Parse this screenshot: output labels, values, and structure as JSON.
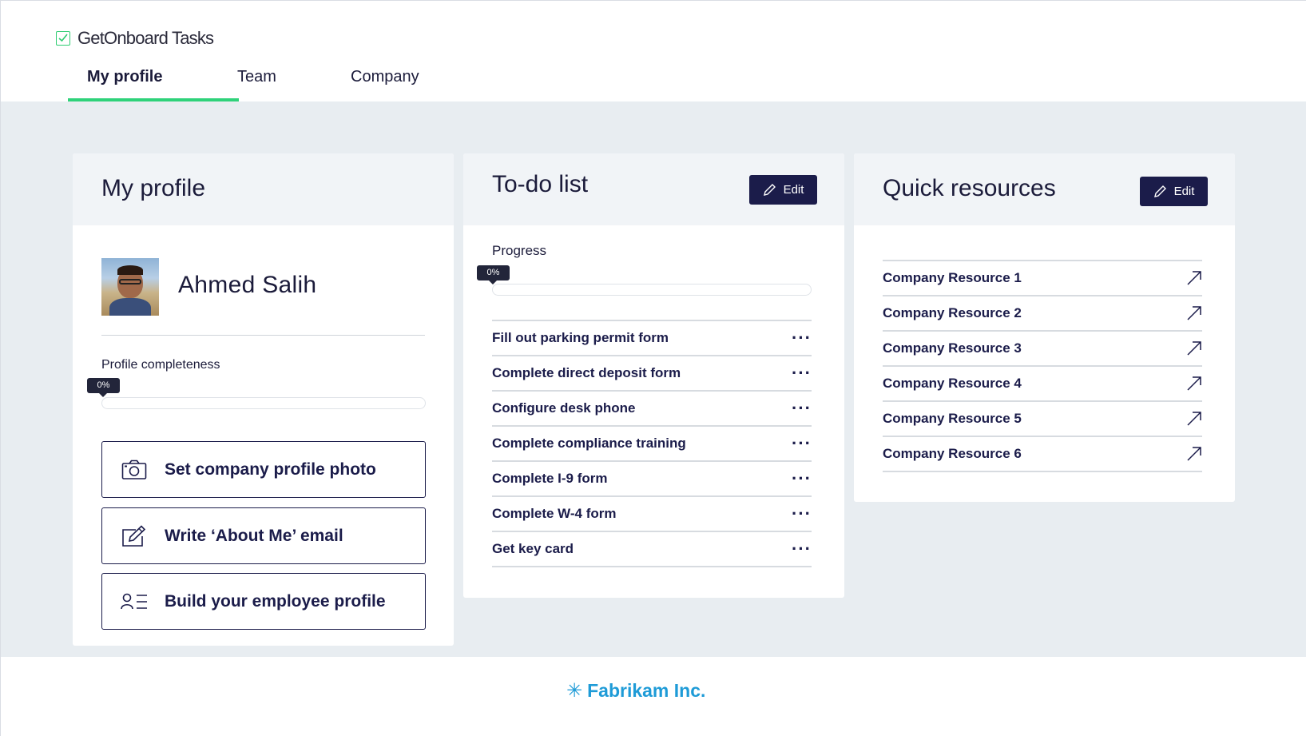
{
  "app": {
    "brand": "GetOnboard Tasks",
    "accent": "#2fd27a",
    "primary": "#1b1c4a"
  },
  "nav": {
    "tabs": [
      {
        "label": "My profile",
        "active": true
      },
      {
        "label": "Team",
        "active": false
      },
      {
        "label": "Company",
        "active": false
      }
    ]
  },
  "profile": {
    "title": "My profile",
    "name": "Ahmed Salih",
    "completeness_label": "Profile completeness",
    "completeness_value": "0%",
    "completeness_fraction": 0,
    "actions": [
      {
        "label": "Set company profile photo",
        "icon": "camera-icon"
      },
      {
        "label": "Write ‘About Me’ email",
        "icon": "edit-note-icon"
      },
      {
        "label": "Build your employee profile",
        "icon": "contact-card-icon"
      }
    ]
  },
  "todo": {
    "title": "To-do list",
    "edit_label": "Edit",
    "progress_label": "Progress",
    "progress_value": "0%",
    "progress_fraction": 0,
    "items": [
      "Fill out parking permit form",
      "Complete direct deposit form",
      "Configure desk phone",
      "Complete compliance training",
      "Complete I-9 form",
      "Complete W-4 form",
      "Get key card"
    ],
    "more_icon": "more-horizontal-icon"
  },
  "resources": {
    "title": "Quick resources",
    "edit_label": "Edit",
    "items": [
      "Company Resource 1",
      "Company Resource 2",
      "Company Resource 3",
      "Company Resource 4",
      "Company Resource 5",
      "Company Resource 6"
    ],
    "link_icon": "external-link-arrow-icon"
  },
  "footer": {
    "company": "Fabrikam Inc.",
    "logo_icon": "asterisk-icon",
    "color": "#1e9bd7"
  }
}
